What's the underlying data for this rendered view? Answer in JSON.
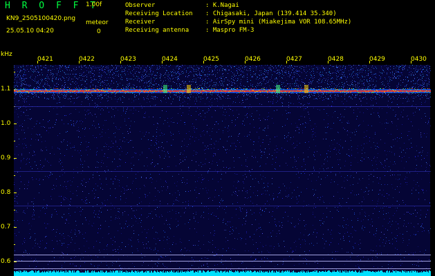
{
  "header": {
    "title": "H R O F F T",
    "version": "1.00f",
    "filename": "KN9_2505100420.png",
    "meteor_label": "meteor",
    "meteor_count": "0",
    "timestamp": "25.05.10 04:20"
  },
  "info": [
    {
      "label": "Observer",
      "value": ": K.Nagai"
    },
    {
      "label": "Receiving Location",
      "value": ": Chigasaki, Japan (139.414 35.340)"
    },
    {
      "label": "Receiver",
      "value": ": AirSpy mini (Miakejima VOR 108.65MHz)"
    },
    {
      "label": "Receiving antenna",
      "value": ": Maspro FM-3"
    }
  ],
  "axes": {
    "y_unit": "kHz",
    "y_ticks": [
      "1.1",
      "1.0",
      "0.9",
      "0.8",
      "0.7",
      "0.6"
    ],
    "x_ticks": [
      "0421",
      "0422",
      "0423",
      "0424",
      "0425",
      "0426",
      "0427",
      "0428",
      "0429",
      "0430"
    ]
  },
  "colors": {
    "background": "#000000",
    "label_yellow": "#ffff00",
    "title_green": "#00ff40",
    "waterfall_base": "#050535",
    "signal_line": "#ff4020",
    "noise_floor": "#00e0ff"
  }
}
